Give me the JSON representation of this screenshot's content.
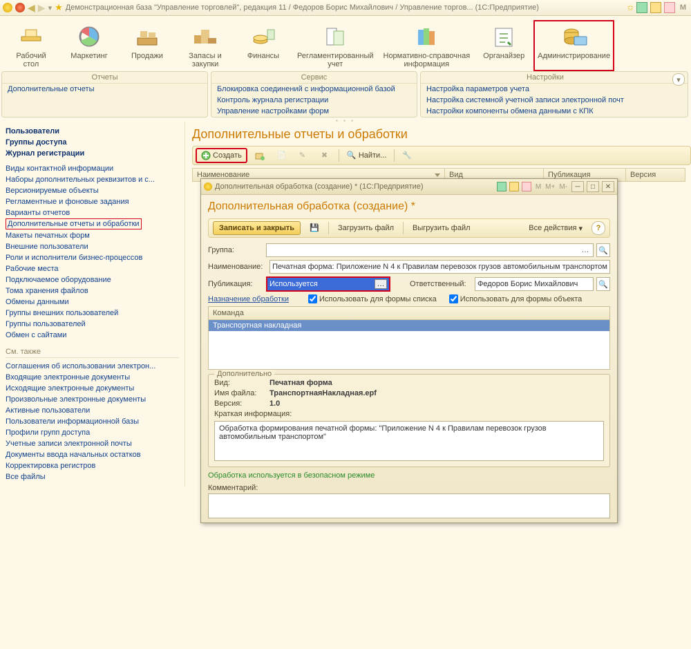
{
  "topbar": {
    "title": "Демонстрационная база \"Управление торговлей\", редакция 11 / Федоров Борис Михайлович / Управление торгов... (1С:Предприятие)"
  },
  "ribbon": [
    {
      "label": "Рабочий\nстол"
    },
    {
      "label": "Маркетинг"
    },
    {
      "label": "Продажи"
    },
    {
      "label": "Запасы и\nзакупки"
    },
    {
      "label": "Финансы"
    },
    {
      "label": "Регламентированный\nучет"
    },
    {
      "label": "Нормативно-справочная\nинформация"
    },
    {
      "label": "Органайзер"
    },
    {
      "label": "Администрирование"
    }
  ],
  "panels": {
    "reports": {
      "title": "Отчеты",
      "items": [
        "Дополнительные отчеты"
      ]
    },
    "service": {
      "title": "Сервис",
      "items": [
        "Блокировка соединений с информационной базой",
        "Контроль журнала регистрации",
        "Управление настройками форм"
      ]
    },
    "settings": {
      "title": "Настройки",
      "items": [
        "Настройка параметров учета",
        "Настройка системной учетной записи электронной почт",
        "Настройки компоненты обмена данными с КПК"
      ]
    }
  },
  "sidebar": {
    "bold": [
      "Пользователи",
      "Группы доступа",
      "Журнал регистрации"
    ],
    "links1": [
      "Виды контактной информации",
      "Наборы дополнительных реквизитов и с...",
      "Версионируемые объекты",
      "Регламентные и фоновые задания",
      "Варианты отчетов",
      "Дополнительные отчеты и обработки",
      "Макеты печатных форм",
      "Внешние пользователи",
      "Роли и исполнители бизнес-процессов",
      "Рабочие места",
      "Подключаемое оборудование",
      "Тома хранения файлов",
      "Обмены данными",
      "Группы внешних пользователей",
      "Группы пользователей",
      "Обмен с сайтами"
    ],
    "sect": "См. также",
    "links2": [
      "Соглашения об использовании электрон...",
      "Входящие электронные документы",
      "Исходящие электронные документы",
      "Произвольные электронные документы",
      "Активные пользователи",
      "Пользователи информационной базы",
      "Профили групп доступа",
      "Учетные записи электронной почты",
      "Документы ввода начальных остатков",
      "Корректировка регистров",
      "Все файлы"
    ]
  },
  "page": {
    "heading": "Дополнительные отчеты и обработки",
    "toolbar": {
      "create": "Создать",
      "find": "Найти..."
    },
    "grid": {
      "c1": "Наименование",
      "c2": "Вид",
      "c3": "Публикация",
      "c4": "Версия"
    }
  },
  "dialog": {
    "wintitle": "Дополнительная обработка (создание) *  (1С:Предприятие)",
    "heading": "Дополнительная обработка (создание) *",
    "tb": {
      "save": "Записать и закрыть",
      "load": "Загрузить файл",
      "unload": "Выгрузить файл",
      "all": "Все действия"
    },
    "labels": {
      "group": "Группа:",
      "name": "Наименование:",
      "pub": "Публикация:",
      "resp": "Ответственный:",
      "assign": "Назначение обработки",
      "uselist": "Использовать для формы списка",
      "useobj": "Использовать для формы объекта",
      "cmdh": "Команда",
      "cmd": "Транспортная накладная",
      "add": "Дополнительно",
      "kind": "Вид:",
      "file": "Имя файла:",
      "ver": "Версия:",
      "short": "Краткая информация:",
      "safe": "Обработка используется в безопасном режиме",
      "comment": "Комментарий:"
    },
    "values": {
      "name": "Печатная форма: Приложение N 4 к Правилам перевозок грузов автомобильным транспортом",
      "pub": "Используется",
      "resp": "Федоров Борис Михайлович",
      "kind": "Печатная форма",
      "file": "ТранспортнаяНакладная.epf",
      "ver": "1.0",
      "info": "Обработка формирования печатной формы: \"Приложение N 4 к Правилам перевозок грузов автомобильным транспортом\""
    }
  }
}
